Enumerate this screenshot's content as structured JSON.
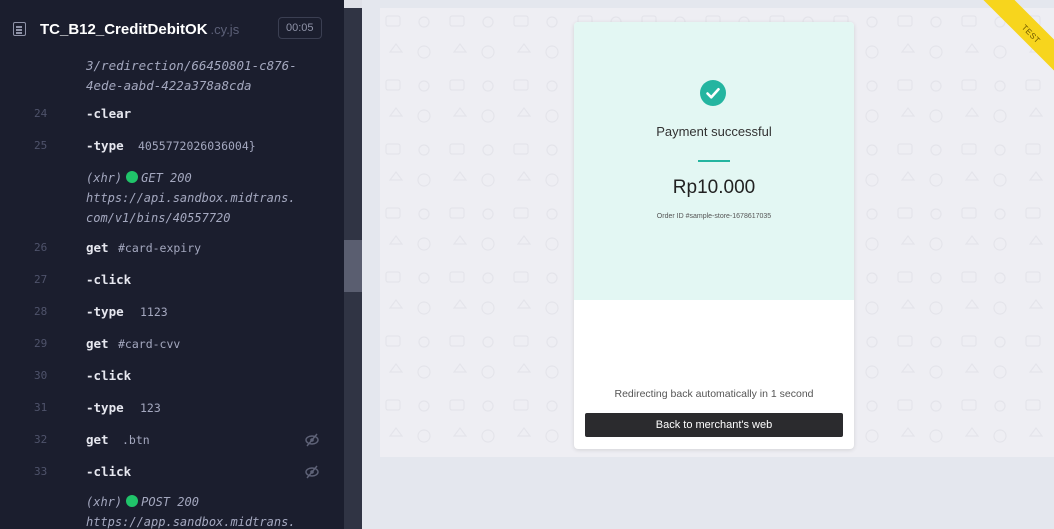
{
  "header": {
    "spec_name": "TC_B12_CreditDebitOK",
    "spec_ext": ".cy.js",
    "timer": "00:05",
    "file_icon": "file-icon"
  },
  "log": {
    "top_cont": [
      "3/redirection/66450801-c876-",
      "4ede-aabd-422a378a8cda"
    ],
    "rows": [
      {
        "num": "24",
        "cmd": "-clear",
        "arg": ""
      },
      {
        "num": "25",
        "cmd": "-type",
        "arg": "4055772026036004}"
      },
      {
        "num": "26",
        "cmd": "get",
        "arg": "#card-expiry"
      },
      {
        "num": "27",
        "cmd": "-click",
        "arg": ""
      },
      {
        "num": "28",
        "cmd": "-type",
        "arg": "1123"
      },
      {
        "num": "29",
        "cmd": "get",
        "arg": "#card-cvv"
      },
      {
        "num": "30",
        "cmd": "-click",
        "arg": ""
      },
      {
        "num": "31",
        "cmd": "-type",
        "arg": "123"
      },
      {
        "num": "32",
        "cmd": "get",
        "arg": ".btn"
      },
      {
        "num": "33",
        "cmd": "-click",
        "arg": ""
      }
    ],
    "xhr1": {
      "prefix": "(xhr)",
      "method": "GET 200",
      "url_line1": "https://api.sandbox.midtrans.",
      "url_line2": "com/v1/bins/40557720"
    },
    "xhr2": {
      "prefix": "(xhr)",
      "method": "POST 200",
      "url_line1": "https://app.sandbox.midtrans."
    },
    "hidden_icon": "eye-off-icon",
    "status_color": "#20c46a"
  },
  "preview": {
    "ribbon": "TEST",
    "payment_title": "Payment successful",
    "amount": "Rp10.000",
    "order_id": "Order ID #sample-store-1678617035",
    "redirect_text": "Redirecting back automatically in 1 second",
    "back_button": "Back to merchant's web",
    "success_icon": "check-circle-icon",
    "accent": "#24b5a0",
    "ribbon_color": "#f7d51d"
  }
}
